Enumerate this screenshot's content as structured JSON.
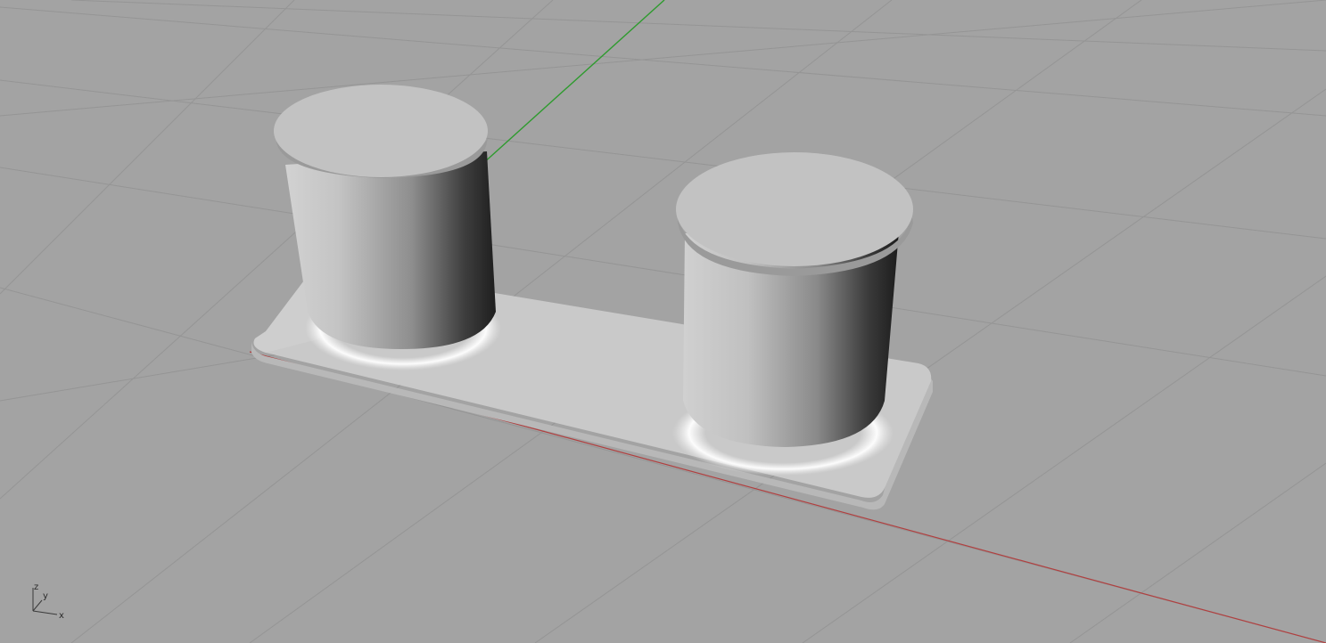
{
  "viewport": {
    "background": "#a3a3a3",
    "grid_color": "#959595",
    "x_axis_color": "#b04040",
    "y_axis_color": "#2e9b2e"
  },
  "model": {
    "base_plate_color": "#cfcfcf",
    "cylinder_color": "#b0b0b0",
    "cap_color": "#c2c2c2"
  },
  "triad": {
    "z_label": "z",
    "y_label": "y",
    "x_label": "x"
  }
}
